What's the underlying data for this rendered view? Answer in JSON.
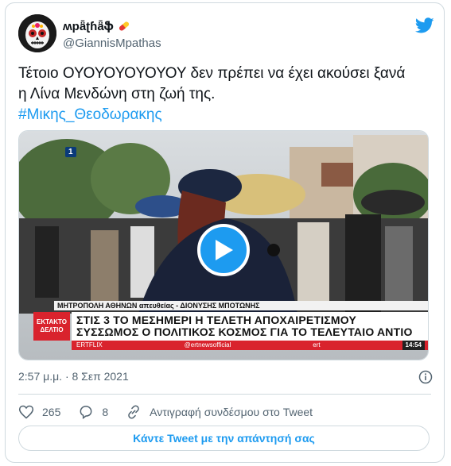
{
  "author": {
    "display_name": "ʍpǟʈɦǟֆ",
    "handle": "@GiannisMpathas",
    "avatar_icon": "sugar-skull-avatar",
    "badge_icon": "pill-emoji"
  },
  "tweet": {
    "text_line1": "Τέτοιο ΟΥΟΥΟΥΟΥΟΥΟΥ δεν πρέπει να έχει ακούσει ξανά",
    "text_line2": "η Λίνα Μενδώνη στη ζωή της.",
    "hashtag": "#Μικης_Θεοδωρακης"
  },
  "video": {
    "channel": "1",
    "location_bar": "ΜΗΤΡΟΠΟΛΗ ΑΘΗΝΩΝ  απευθείας - ΔΙΟΝΥΣΗΣ ΜΠΟΤΩΝΗΣ",
    "live_badge_line1": "ΕΚΤΑΚΤΟ",
    "live_badge_line2": "ΔΕΛΤΙΟ",
    "headline_line1": "ΣΤΙΣ 3 ΤΟ ΜΕΣΗΜΕΡΙ Η ΤΕΛΕΤΗ ΑΠΟΧΑΙΡΕΤΙΣΜΟΥ",
    "headline_line2": "ΣΥΣΣΩΜΟΣ Ο ΠΟΛΙΤΙΚΟΣ ΚΟΣΜΟΣ ΓΙΑ ΤΟ ΤΕΛΕΥΤΑΙΟ ΑΝΤΙΟ",
    "ticker_left": "ERTFLIX",
    "ticker_mid": "@ertnewsofficial",
    "ticker_right": "ert",
    "ticker_time": "14:54",
    "play_icon": "play-icon"
  },
  "meta": {
    "timestamp": "2:57 μ.μ. · 8 Σεπ 2021"
  },
  "actions": {
    "likes": "265",
    "replies": "8",
    "copy_link": "Αντιγραφή συνδέσμου στο Tweet"
  },
  "reply_button": "Κάντε Tweet με την απάντησή σας",
  "colors": {
    "accent": "#1d9bf0",
    "text": "#0f1419",
    "muted": "#536471",
    "border": "#cfd9de",
    "news_red": "#d9232d"
  }
}
